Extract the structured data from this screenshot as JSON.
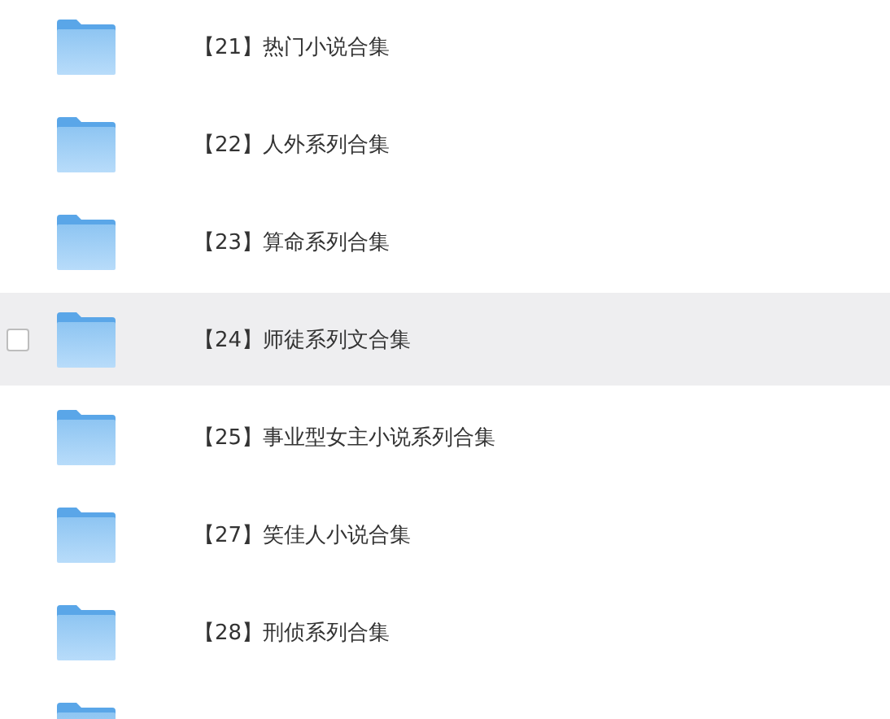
{
  "files": [
    {
      "name": "【21】热门小说合集",
      "hovered": false,
      "checked": false
    },
    {
      "name": "【22】人外系列合集",
      "hovered": false,
      "checked": false
    },
    {
      "name": "【23】算命系列合集",
      "hovered": false,
      "checked": false
    },
    {
      "name": "【24】师徒系列文合集",
      "hovered": true,
      "checked": false
    },
    {
      "name": "【25】事业型女主小说系列合集",
      "hovered": false,
      "checked": false
    },
    {
      "name": "【27】笑佳人小说合集",
      "hovered": false,
      "checked": false
    },
    {
      "name": "【28】刑侦系列合集",
      "hovered": false,
      "checked": false
    },
    {
      "hovered": false,
      "checked": false
    }
  ]
}
